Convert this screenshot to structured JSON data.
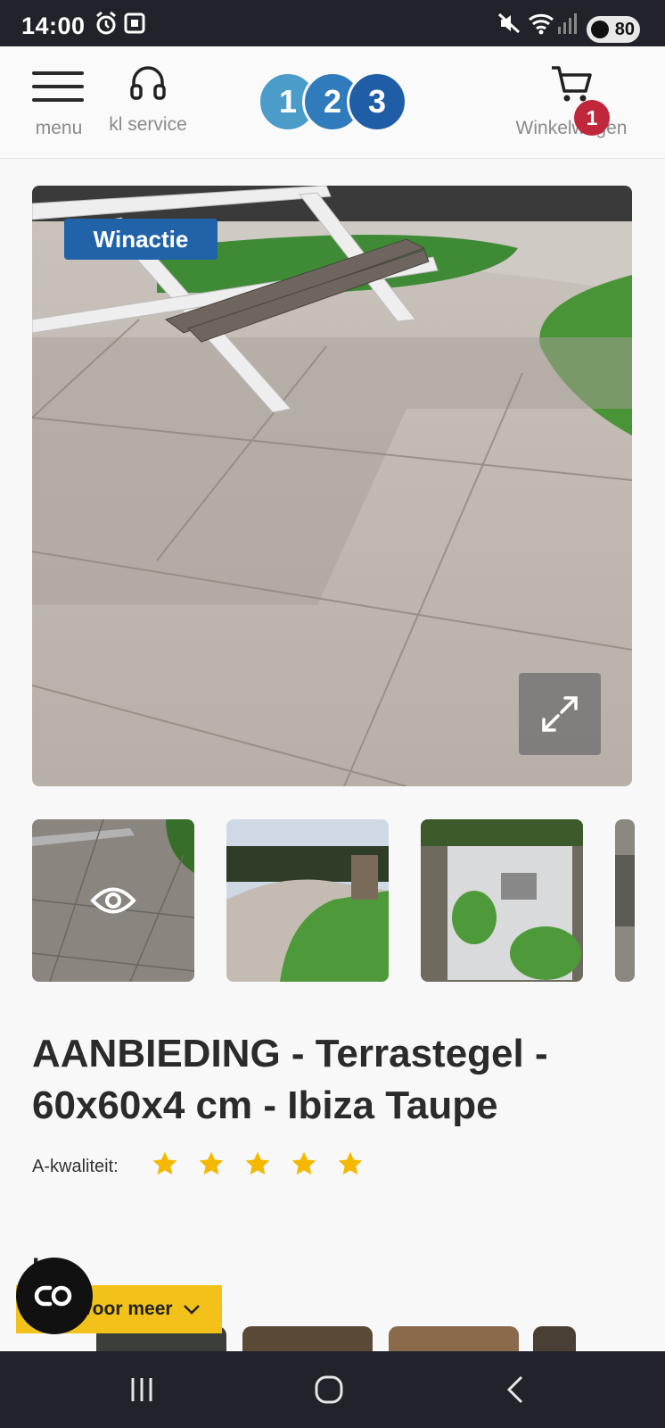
{
  "status_bar": {
    "time": "14:00",
    "battery": "80"
  },
  "header": {
    "menu_label": "menu",
    "service_label": "kl service",
    "logo_digits": [
      "1",
      "2",
      "3"
    ],
    "cart_label": "Winkelwagen",
    "cart_count": "1"
  },
  "product": {
    "badge": "Winactie",
    "title": "AANBIEDING - Terrastegel - 60x60x4 cm - Ibiza Taupe",
    "quality_label": "A-kwaliteit:",
    "quality_stars": 5
  },
  "section": {
    "title": "Ins",
    "more_button": "voor meer"
  },
  "icons": [
    "alarm-icon",
    "screenshot-icon",
    "mute-icon",
    "wifi-icon",
    "signal-icon",
    "menu-icon",
    "headphones-icon",
    "cart-icon",
    "expand-icon",
    "eye-icon",
    "star-icon",
    "chevron-down-icon",
    "chat-icon",
    "recent-apps-icon",
    "home-icon",
    "back-icon"
  ],
  "colors": {
    "brand_blue": "#2163a8",
    "badge_red": "#c0273b",
    "cta_yellow": "#f2c21b",
    "star_yellow": "#f5b800"
  }
}
